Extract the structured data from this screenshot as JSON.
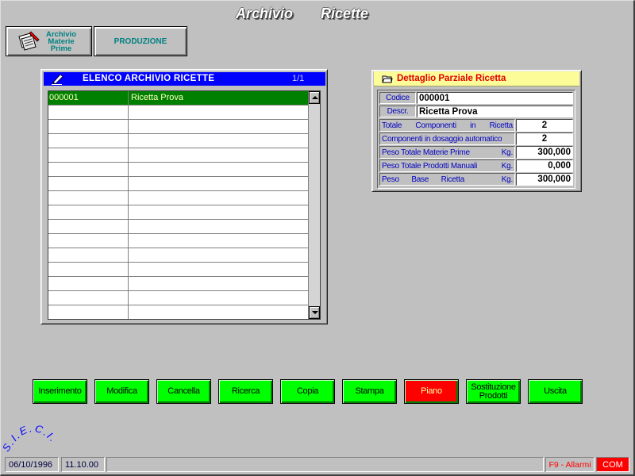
{
  "window": {
    "title_left": "Archivio",
    "title_right": "Ricette"
  },
  "toolbar": {
    "materie_prime": {
      "icon": "archive-documents-icon",
      "label_lines": [
        "Archivio",
        "Materie",
        "Prime"
      ]
    },
    "produzione": {
      "label": "PRODUZIONE"
    }
  },
  "list": {
    "icon": "pen-writing-icon",
    "title": "ELENCO ARCHIVIO RICETTE",
    "page": "1/1",
    "rows": [
      {
        "code": "000001",
        "name": "Ricetta Prova",
        "selected": true
      }
    ]
  },
  "detail": {
    "icon": "open-folder-icon",
    "title": "Dettaglio Parziale Ricetta",
    "codice": {
      "label": "Codice",
      "value": "000001"
    },
    "descr": {
      "label": "Descr.",
      "value": "Ricetta Prova"
    },
    "fields": [
      {
        "label": "Totale Componenti in Ricetta",
        "unit": "",
        "value": "2"
      },
      {
        "label": "Componenti in dosaggio automatico",
        "unit": "",
        "value": "2"
      },
      {
        "label": "Peso Totale Materie Prime",
        "unit": "Kg.",
        "value": "300,000"
      },
      {
        "label": "Peso Totale Prodotti Manuali",
        "unit": "Kg.",
        "value": "0,000"
      },
      {
        "label": "Peso Base Ricetta",
        "unit": "Kg.",
        "value": "300,000"
      }
    ]
  },
  "actions": [
    {
      "label": "Inserimento",
      "color": "#00ff00",
      "text_color": "#000000"
    },
    {
      "label": "Modifica",
      "color": "#00ff00",
      "text_color": "#000000"
    },
    {
      "label": "Cancella",
      "color": "#00ff00",
      "text_color": "#000000"
    },
    {
      "label": "Ricerca",
      "color": "#00ff00",
      "text_color": "#000000"
    },
    {
      "label": "Copia",
      "color": "#00ff00",
      "text_color": "#000000"
    },
    {
      "label": "Stampa",
      "color": "#00ff00",
      "text_color": "#000000"
    },
    {
      "label": "Piano",
      "color": "#ff0000",
      "text_color": "#ffffa0"
    },
    {
      "label": "Sostituzione Prodotti",
      "color": "#00ff00",
      "text_color": "#000000"
    },
    {
      "label": "Uscita",
      "color": "#00ff00",
      "text_color": "#000000"
    }
  ],
  "logo": {
    "text": "S.I.E.C.I."
  },
  "status": {
    "date": "06/10/1996",
    "time": "11.10.00",
    "message": "",
    "alarms": "F9 - Allarmi",
    "com": "COM"
  },
  "colors": {
    "background": "#c0c0c0",
    "list_title_bar": "#0000ff",
    "detail_title_bar": "#fcfc98",
    "detail_title_text": "#e00000",
    "detail_label_text": "#0000c0",
    "selected_row": "#008000",
    "selected_row_text": "#ffffc0",
    "toolbar_label_text": "#008080",
    "alarm_text": "#ff0000",
    "com_indicator": "#ff0000"
  }
}
